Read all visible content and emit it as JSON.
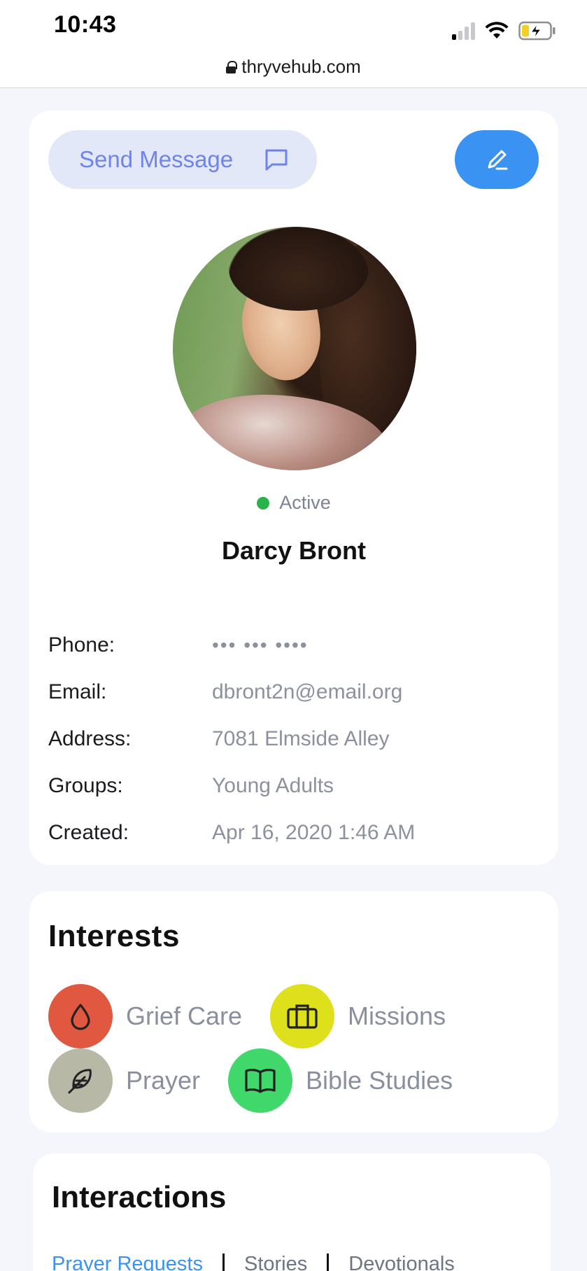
{
  "status_bar": {
    "time": "10:43"
  },
  "browser": {
    "url": "thryvehub.com"
  },
  "profile": {
    "send_message_label": "Send Message",
    "status": "Active",
    "name": "Darcy Bront",
    "fields": [
      {
        "label": "Phone:",
        "value": "••• ••• ••••"
      },
      {
        "label": "Email:",
        "value": "dbront2n@email.org"
      },
      {
        "label": "Address:",
        "value": "7081 Elmside Alley"
      },
      {
        "label": "Groups:",
        "value": "Young Adults"
      },
      {
        "label": "Created:",
        "value": "Apr 16, 2020 1:46 AM"
      }
    ]
  },
  "interests": {
    "title": "Interests",
    "items": [
      {
        "label": "Grief Care",
        "icon": "drop-icon",
        "color": "#e0583f"
      },
      {
        "label": "Missions",
        "icon": "briefcase-icon",
        "color": "#dde01a"
      },
      {
        "label": "Prayer",
        "icon": "feather-icon",
        "color": "#b7b9a6"
      },
      {
        "label": "Bible Studies",
        "icon": "book-icon",
        "color": "#40d86a"
      }
    ]
  },
  "interactions": {
    "title": "Interactions",
    "tabs": [
      "Prayer Requests",
      "Stories",
      "Devotionals"
    ]
  },
  "colors": {
    "accent": "#3a93f2",
    "send_button_bg": "#e3e8f8",
    "status_active": "#27b24a"
  }
}
